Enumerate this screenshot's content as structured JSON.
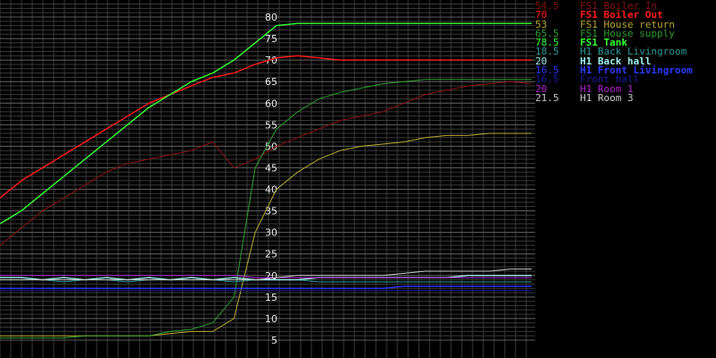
{
  "chart_data": {
    "type": "line",
    "ylim": [
      0,
      82
    ],
    "grid": true,
    "legend_position": "right",
    "y_ticks": [
      5,
      10,
      15,
      20,
      25,
      30,
      35,
      40,
      45,
      50,
      55,
      60,
      65,
      70,
      75,
      80
    ],
    "x": [
      0,
      4,
      8,
      12,
      16,
      20,
      24,
      28,
      32,
      36,
      40,
      44,
      48,
      52,
      56,
      60,
      64,
      68,
      72,
      76,
      80,
      84,
      88,
      92,
      96,
      100
    ],
    "series": [
      {
        "name": "FS1 Boiler In",
        "current": "54.5",
        "color": "#8a1010",
        "bold": false,
        "values": [
          27,
          31,
          35,
          38,
          41,
          44,
          46,
          47,
          48,
          49,
          51,
          45,
          47,
          50,
          52,
          54,
          56,
          57,
          58,
          60,
          62,
          63,
          64,
          64.5,
          65,
          64.5
        ]
      },
      {
        "name": "FS1 Boiler Out",
        "current": "70",
        "color": "#ff1a1a",
        "bold": true,
        "values": [
          38,
          42,
          45,
          48,
          51,
          54,
          57,
          60,
          62,
          64,
          66,
          67,
          69,
          70.5,
          71,
          70.5,
          70,
          70,
          70,
          70,
          70,
          70,
          70,
          70,
          70,
          70
        ]
      },
      {
        "name": "FS1 House return",
        "current": "53",
        "color": "#b8a830",
        "bold": false,
        "values": [
          6,
          6,
          6,
          6,
          6,
          6,
          6,
          6,
          6.5,
          7,
          7,
          10,
          30,
          40,
          44,
          47,
          49,
          50,
          50.5,
          51,
          52,
          52.5,
          52.5,
          53,
          53,
          53
        ]
      },
      {
        "name": "FS1 House supply",
        "current": "65.5",
        "color": "#2e9e2e",
        "bold": false,
        "values": [
          5.5,
          5.5,
          5.5,
          5.5,
          6,
          6,
          6,
          6,
          7,
          7.5,
          9,
          15,
          45,
          54,
          58,
          61,
          62.5,
          63.5,
          64.5,
          65,
          65.5,
          65.5,
          65.5,
          65.5,
          65.5,
          65.5
        ]
      },
      {
        "name": "FS1 Tank",
        "current": "78.5",
        "color": "#33ff33",
        "bold": true,
        "values": [
          32,
          35,
          39,
          43,
          47,
          51,
          55,
          59,
          62,
          65,
          67,
          70,
          74,
          78,
          78.5,
          78.5,
          78.5,
          78.5,
          78.5,
          78.5,
          78.5,
          78.5,
          78.5,
          78.5,
          78.5,
          78.5
        ]
      },
      {
        "name": "H1 Back Livingroom",
        "current": "18.5",
        "color": "#2a9a9a",
        "bold": false,
        "values": [
          19,
          19,
          19,
          18.5,
          19,
          19,
          18.5,
          19,
          19,
          19,
          19,
          18.5,
          19,
          19,
          19,
          18.5,
          18.5,
          18.5,
          18.5,
          18.5,
          18.5,
          18.5,
          18.5,
          18.5,
          18.5,
          18.5
        ]
      },
      {
        "name": "H1 Back hall",
        "current": "20",
        "color": "#9ff0f0",
        "bold": true,
        "values": [
          19.5,
          19.5,
          19,
          19.5,
          19,
          19.5,
          19,
          19.5,
          19,
          19.5,
          19,
          19.5,
          19,
          19,
          19,
          19.5,
          19.5,
          19.5,
          19.5,
          19.5,
          19.5,
          19.5,
          20,
          20,
          20,
          20
        ]
      },
      {
        "name": "H1 Front Livingroom",
        "current": "16.5",
        "color": "#2a3aff",
        "bold": true,
        "values": [
          17,
          17,
          17,
          17,
          17,
          17,
          17,
          17,
          17,
          17,
          17,
          17,
          17,
          17,
          17,
          17,
          17,
          17,
          17,
          17.5,
          17.5,
          17.5,
          17.5,
          17.5,
          17.5,
          17.5
        ]
      },
      {
        "name": "Front hall",
        "current": "16.5",
        "color": "#1a1aa0",
        "bold": false,
        "values": [
          16.5,
          16.5,
          16.5,
          16.5,
          16.5,
          16.5,
          16.5,
          16.5,
          16.5,
          16.5,
          16.5,
          16.5,
          16.5,
          16.5,
          16.5,
          16.5,
          16.5,
          16.5,
          16.5,
          16.5,
          16.5,
          16.5,
          16.5,
          16.5,
          16.5,
          16.5
        ]
      },
      {
        "name": "H1 Room 1",
        "current": "20",
        "color": "#b020d0",
        "bold": false,
        "values": [
          20,
          20,
          20,
          20,
          20,
          20,
          20,
          20,
          20,
          20,
          20,
          20,
          19.5,
          19.5,
          19.5,
          19.5,
          19.5,
          19.5,
          19.5,
          19.5,
          19.5,
          19.5,
          19.5,
          19.5,
          19.5,
          19.5
        ]
      },
      {
        "name": "H1 Room 3",
        "current": "21.5",
        "color": "#c8c8c8",
        "bold": false,
        "values": [
          19,
          19,
          19,
          19,
          19,
          19,
          19,
          19,
          19,
          19,
          19,
          19,
          19,
          19.5,
          20,
          20,
          20,
          20,
          20,
          20.5,
          21,
          21,
          21,
          21,
          21.5,
          21.5
        ]
      }
    ]
  }
}
